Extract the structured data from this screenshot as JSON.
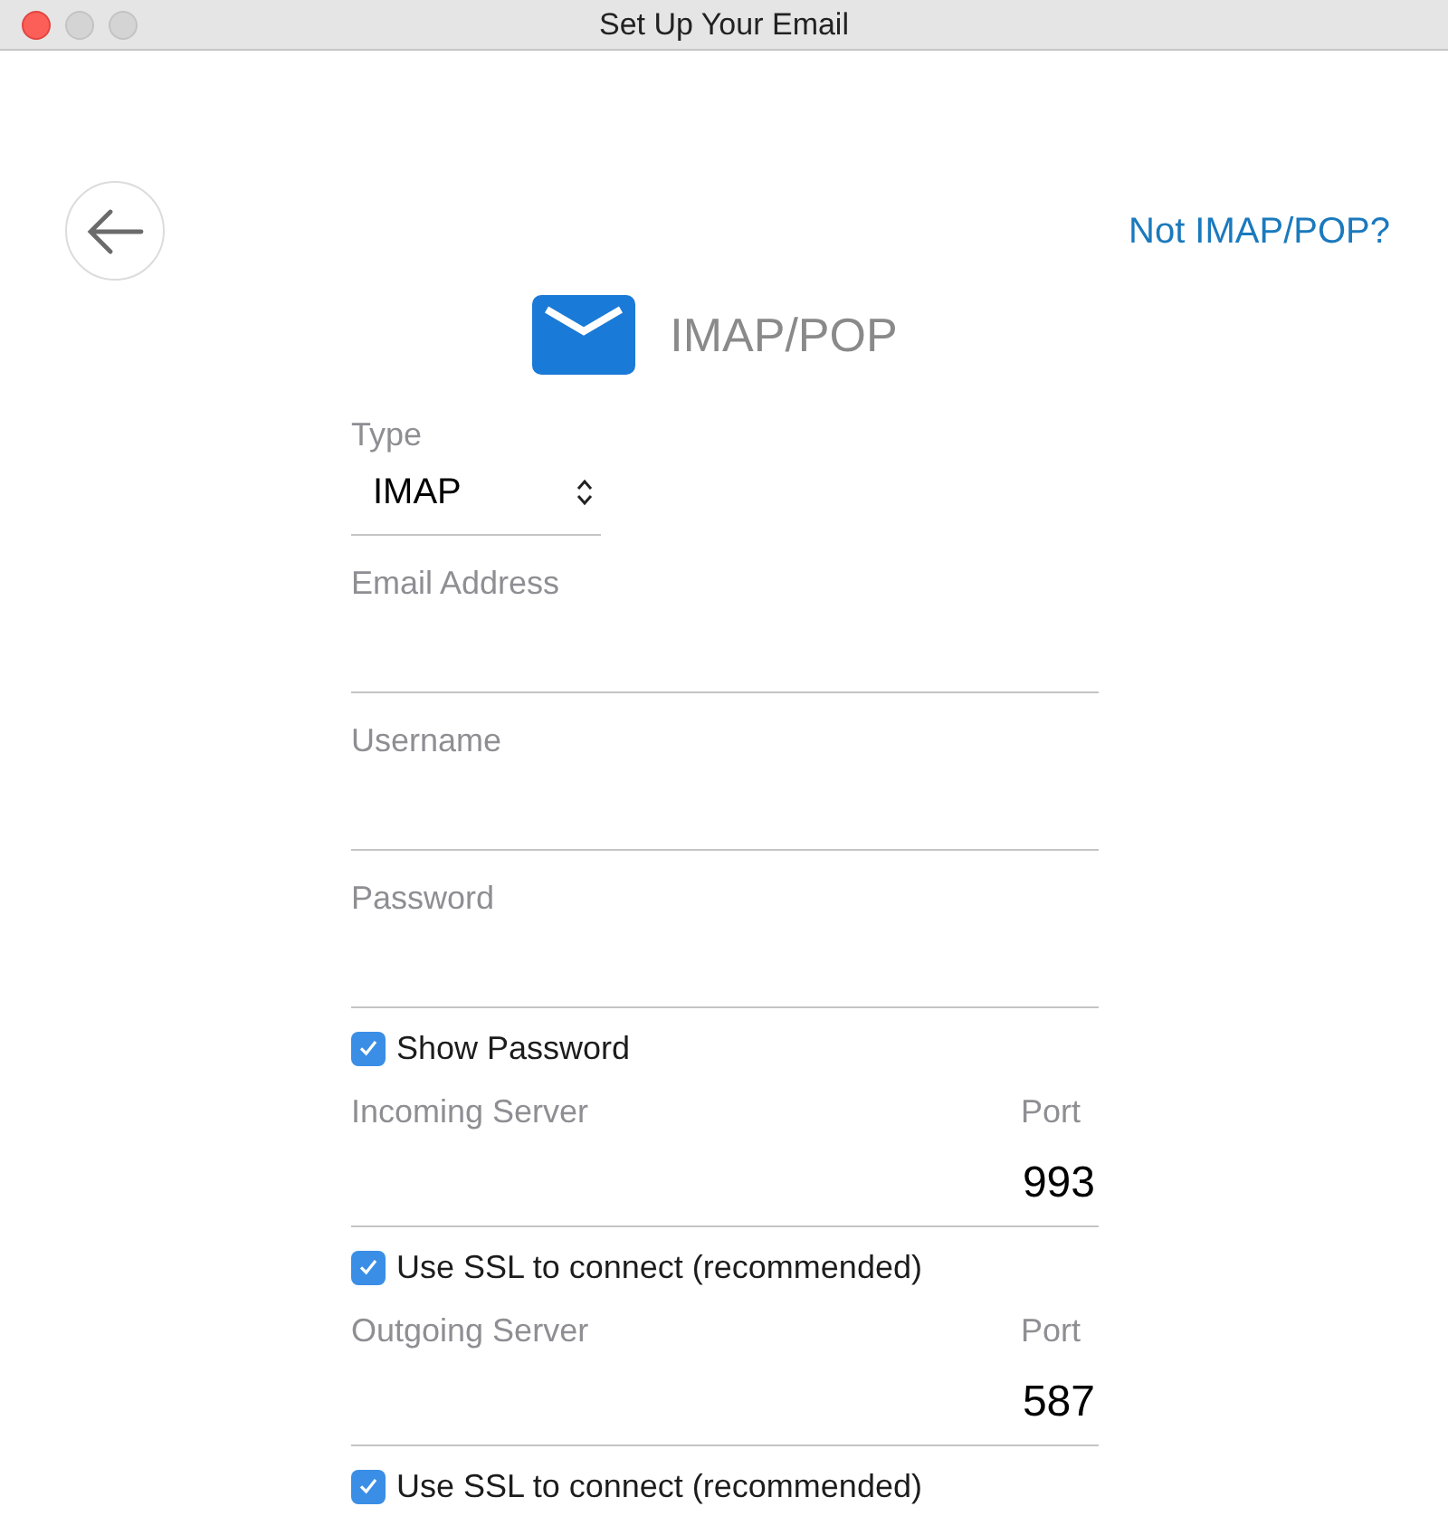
{
  "window": {
    "title": "Set Up Your Email"
  },
  "header": {
    "link": "Not IMAP/POP?",
    "account_type": "IMAP/POP"
  },
  "type_field": {
    "label": "Type",
    "value": "IMAP"
  },
  "fields": [
    {
      "kind": "text",
      "label": "Email Address"
    },
    {
      "kind": "text",
      "label": "Username"
    },
    {
      "kind": "text",
      "label": "Password"
    },
    {
      "kind": "checkbox",
      "label": "Show Password",
      "checked": true
    },
    {
      "kind": "server",
      "label": "Incoming Server",
      "port_label": "Port",
      "port": "993"
    },
    {
      "kind": "checkbox",
      "label": "Use SSL to connect (recommended)",
      "checked": true
    },
    {
      "kind": "server",
      "label": "Outgoing Server",
      "port_label": "Port",
      "port": "587"
    },
    {
      "kind": "checkbox",
      "label": "Use SSL to connect (recommended)",
      "checked": true
    }
  ]
}
